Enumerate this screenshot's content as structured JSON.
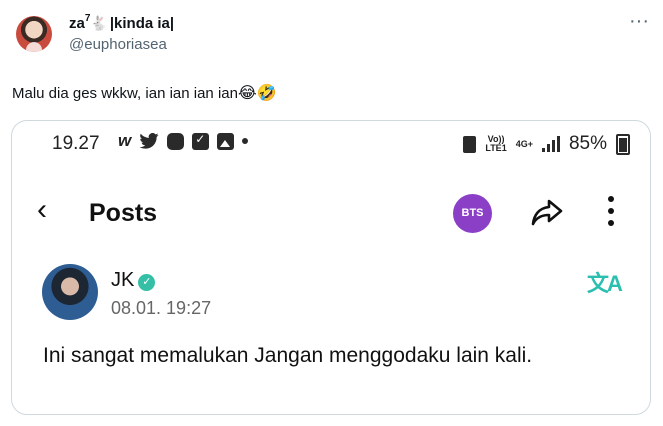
{
  "tweet": {
    "display_name": "za",
    "display_name_sup": "7",
    "display_name_suffix": "|kinda ia|",
    "handle": "@euphoriasea",
    "more_glyph": "···",
    "text": "Malu dia ges wkkw, ian ian ian ian",
    "emojis": "😂🤣"
  },
  "screenshot": {
    "status_bar": {
      "time": "19.27",
      "volte": "Vo))",
      "lte": "LTE1",
      "network": "4G+",
      "battery": "85%"
    },
    "top_bar": {
      "title": "Posts",
      "badge": "BTS"
    },
    "post": {
      "author": "JK",
      "date": "08.01. 19:27",
      "translate_glyph": "文A",
      "body": "Ini sangat memalukan Jangan menggodaku lain kali."
    }
  },
  "icons": [
    "avatar",
    "rabbit-icon",
    "more-icon",
    "weverse-icon",
    "twitter-icon",
    "bilibili-icon",
    "check-icon",
    "image-icon",
    "recycle-icon",
    "signal-icon",
    "battery-icon",
    "back-icon",
    "share-icon",
    "kebab-icon",
    "verified-icon",
    "translate-icon"
  ],
  "colors": {
    "verified": "#35bfa6",
    "bts_badge": "#8b3fc7",
    "translate": "#2bbfb0",
    "muted": "#536471"
  }
}
